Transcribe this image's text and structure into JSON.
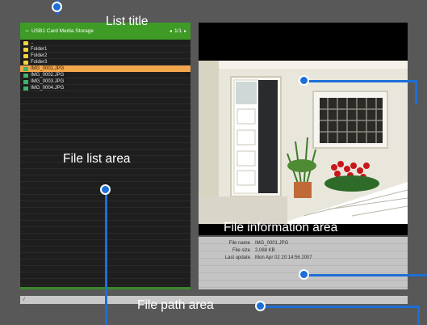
{
  "list": {
    "header_title": "USB1 Card Media Storage",
    "page_indicator": "1/1",
    "items": [
      {
        "label": "..",
        "type": "folder"
      },
      {
        "label": "Folder1",
        "type": "folder"
      },
      {
        "label": "Folder2",
        "type": "folder"
      },
      {
        "label": "Folder3",
        "type": "folder"
      },
      {
        "label": "IMG_0001.JPG",
        "type": "image",
        "selected": true
      },
      {
        "label": "IMG_0002.JPG",
        "type": "image"
      },
      {
        "label": "IMG_0003.JPG",
        "type": "image"
      },
      {
        "label": "IMG_0004.JPG",
        "type": "image"
      }
    ]
  },
  "info": {
    "rows": [
      {
        "key": "File name",
        "value": "IMG_0001.JPG"
      },
      {
        "key": "File size",
        "value": "2,088 KB"
      },
      {
        "key": "Last update",
        "value": "Mon Apr 02 20:14:56 2007"
      }
    ]
  },
  "path": {
    "text": "/"
  },
  "callouts": {
    "list_title": "List title",
    "file_list_area": "File list area",
    "file_information_area": "File information area",
    "file_path_area": "File path area"
  },
  "colors": {
    "header_green": "#3e9b26",
    "selection_orange": "#f3a64c",
    "callout_blue": "#1d6fd8"
  }
}
